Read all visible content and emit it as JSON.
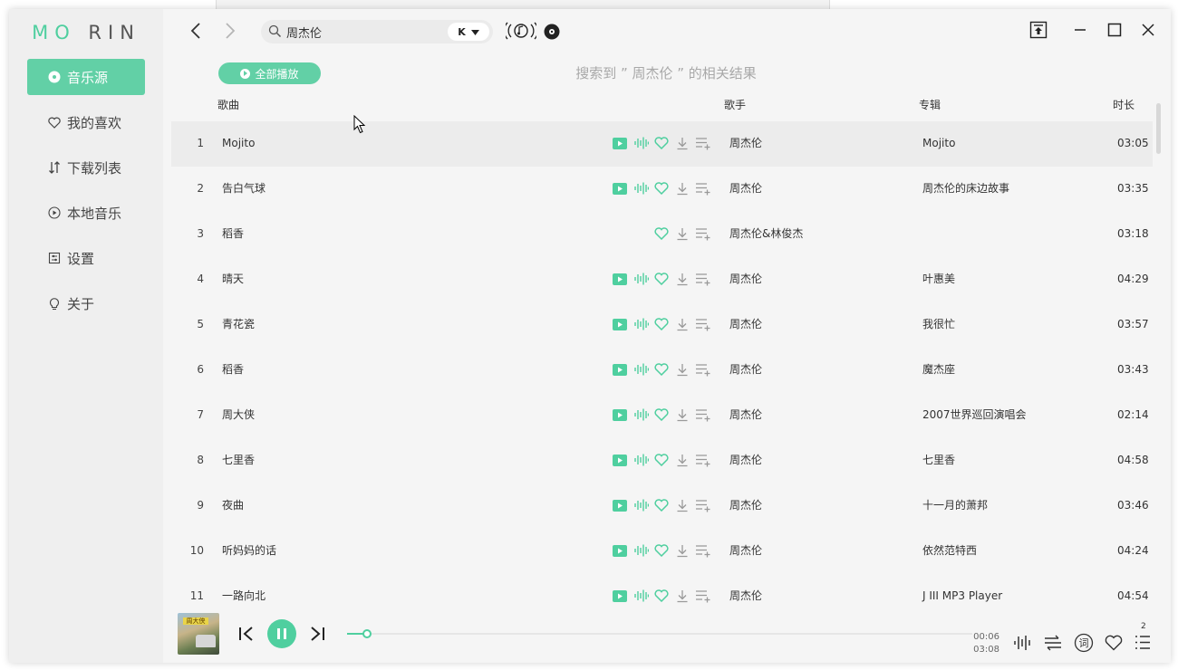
{
  "app": {
    "logo_left": "MO",
    "logo_right": "RIN"
  },
  "sidebar": {
    "items": [
      {
        "label": "音乐源",
        "icon": "disc-icon",
        "active": true
      },
      {
        "label": "我的喜欢",
        "icon": "heart-icon",
        "active": false
      },
      {
        "label": "下载列表",
        "icon": "sort-arrows-icon",
        "active": false
      },
      {
        "label": "本地音乐",
        "icon": "play-circle-icon",
        "active": false
      },
      {
        "label": "设置",
        "icon": "settings-icon",
        "active": false
      },
      {
        "label": "关于",
        "icon": "lightbulb-icon",
        "active": false
      }
    ]
  },
  "search": {
    "value": "周杰伦",
    "source_label": "K"
  },
  "main": {
    "play_all": "全部播放",
    "result_title": "搜索到 ” 周杰伦 ” 的相关结果",
    "columns": {
      "song": "歌曲",
      "artist": "歌手",
      "album": "专辑",
      "duration": "时长"
    }
  },
  "songs": [
    {
      "num": "1",
      "title": "Mojito",
      "artist": "周杰伦",
      "album": "Mojito",
      "duration": "03:05",
      "playable": true
    },
    {
      "num": "2",
      "title": "告白气球",
      "artist": "周杰伦",
      "album": "周杰伦的床边故事",
      "duration": "03:35",
      "playable": true
    },
    {
      "num": "3",
      "title": "稻香",
      "artist": "周杰伦&林俊杰",
      "album": "",
      "duration": "03:18",
      "playable": false
    },
    {
      "num": "4",
      "title": "晴天",
      "artist": "周杰伦",
      "album": "叶惠美",
      "duration": "04:29",
      "playable": true
    },
    {
      "num": "5",
      "title": "青花瓷",
      "artist": "周杰伦",
      "album": "我很忙",
      "duration": "03:57",
      "playable": true
    },
    {
      "num": "6",
      "title": "稻香",
      "artist": "周杰伦",
      "album": "魔杰座",
      "duration": "03:43",
      "playable": true
    },
    {
      "num": "7",
      "title": "周大侠",
      "artist": "周杰伦",
      "album": "2007世界巡回演唱会",
      "duration": "02:14",
      "playable": true
    },
    {
      "num": "8",
      "title": "七里香",
      "artist": "周杰伦",
      "album": "七里香",
      "duration": "04:58",
      "playable": true
    },
    {
      "num": "9",
      "title": "夜曲",
      "artist": "周杰伦",
      "album": "十一月的萧邦",
      "duration": "03:46",
      "playable": true
    },
    {
      "num": "10",
      "title": "听妈妈的话",
      "artist": "周杰伦",
      "album": "依然范特西",
      "duration": "04:24",
      "playable": true
    },
    {
      "num": "11",
      "title": "一路向北",
      "artist": "周杰伦",
      "album": "J III MP3 Player",
      "duration": "04:54",
      "playable": true
    }
  ],
  "player": {
    "current_time": "00:06",
    "total_time": "03:08",
    "progress": 0.032,
    "playlist_count": "2",
    "cover_text": "周大侠",
    "lyric_label": "词"
  },
  "colors": {
    "accent": "#4fcf9f",
    "nav_active": "#62d0a6",
    "icon_gray": "#999999"
  }
}
